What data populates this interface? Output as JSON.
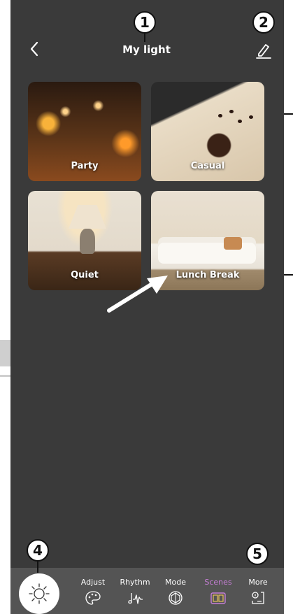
{
  "header": {
    "title": "My light",
    "callouts": [
      "1",
      "2"
    ]
  },
  "scenes": [
    {
      "label": "Party"
    },
    {
      "label": "Casual"
    },
    {
      "label": "Quiet"
    },
    {
      "label": "Lunch Break"
    }
  ],
  "tabbar": {
    "callouts": [
      "4",
      "5"
    ],
    "tabs": [
      {
        "label": "Adjust",
        "icon": "palette-icon",
        "active": false
      },
      {
        "label": "Rhythm",
        "icon": "music-wave-icon",
        "active": false
      },
      {
        "label": "Mode",
        "icon": "mode-icon",
        "active": false
      },
      {
        "label": "Scenes",
        "icon": "scenes-icon",
        "active": true
      },
      {
        "label": "More",
        "icon": "more-icon",
        "active": false
      }
    ]
  },
  "colors": {
    "background": "#3a3a3a",
    "tabbar": "#545454",
    "active_tab": "#c77fd7",
    "text": "#ffffff"
  }
}
